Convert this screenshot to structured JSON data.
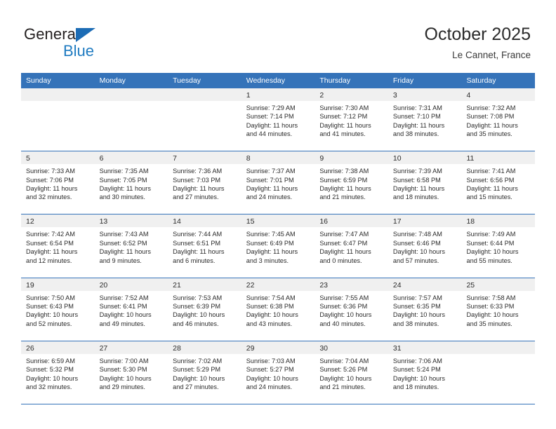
{
  "logo": {
    "word_one": "General",
    "word_two": "Blue",
    "triangle_icon": "triangle-icon",
    "brand_blue": "#1f7bc1",
    "brand_dark": "#231f20"
  },
  "header": {
    "title": "October 2025",
    "location": "Le Cannet, France"
  },
  "theme": {
    "header_blue": "#3573b9",
    "daynum_band": "#f0f0f0",
    "text": "#2b2b2b"
  },
  "weekdays": [
    "Sunday",
    "Monday",
    "Tuesday",
    "Wednesday",
    "Thursday",
    "Friday",
    "Saturday"
  ],
  "weeks": [
    [
      {
        "day": "",
        "empty": true,
        "sunrise": "",
        "sunset": "",
        "daylight_1": "",
        "daylight_2": ""
      },
      {
        "day": "",
        "empty": true,
        "sunrise": "",
        "sunset": "",
        "daylight_1": "",
        "daylight_2": ""
      },
      {
        "day": "",
        "empty": true,
        "sunrise": "",
        "sunset": "",
        "daylight_1": "",
        "daylight_2": ""
      },
      {
        "day": "1",
        "empty": false,
        "sunrise": "Sunrise: 7:29 AM",
        "sunset": "Sunset: 7:14 PM",
        "daylight_1": "Daylight: 11 hours",
        "daylight_2": "and 44 minutes."
      },
      {
        "day": "2",
        "empty": false,
        "sunrise": "Sunrise: 7:30 AM",
        "sunset": "Sunset: 7:12 PM",
        "daylight_1": "Daylight: 11 hours",
        "daylight_2": "and 41 minutes."
      },
      {
        "day": "3",
        "empty": false,
        "sunrise": "Sunrise: 7:31 AM",
        "sunset": "Sunset: 7:10 PM",
        "daylight_1": "Daylight: 11 hours",
        "daylight_2": "and 38 minutes."
      },
      {
        "day": "4",
        "empty": false,
        "sunrise": "Sunrise: 7:32 AM",
        "sunset": "Sunset: 7:08 PM",
        "daylight_1": "Daylight: 11 hours",
        "daylight_2": "and 35 minutes."
      }
    ],
    [
      {
        "day": "5",
        "empty": false,
        "sunrise": "Sunrise: 7:33 AM",
        "sunset": "Sunset: 7:06 PM",
        "daylight_1": "Daylight: 11 hours",
        "daylight_2": "and 32 minutes."
      },
      {
        "day": "6",
        "empty": false,
        "sunrise": "Sunrise: 7:35 AM",
        "sunset": "Sunset: 7:05 PM",
        "daylight_1": "Daylight: 11 hours",
        "daylight_2": "and 30 minutes."
      },
      {
        "day": "7",
        "empty": false,
        "sunrise": "Sunrise: 7:36 AM",
        "sunset": "Sunset: 7:03 PM",
        "daylight_1": "Daylight: 11 hours",
        "daylight_2": "and 27 minutes."
      },
      {
        "day": "8",
        "empty": false,
        "sunrise": "Sunrise: 7:37 AM",
        "sunset": "Sunset: 7:01 PM",
        "daylight_1": "Daylight: 11 hours",
        "daylight_2": "and 24 minutes."
      },
      {
        "day": "9",
        "empty": false,
        "sunrise": "Sunrise: 7:38 AM",
        "sunset": "Sunset: 6:59 PM",
        "daylight_1": "Daylight: 11 hours",
        "daylight_2": "and 21 minutes."
      },
      {
        "day": "10",
        "empty": false,
        "sunrise": "Sunrise: 7:39 AM",
        "sunset": "Sunset: 6:58 PM",
        "daylight_1": "Daylight: 11 hours",
        "daylight_2": "and 18 minutes."
      },
      {
        "day": "11",
        "empty": false,
        "sunrise": "Sunrise: 7:41 AM",
        "sunset": "Sunset: 6:56 PM",
        "daylight_1": "Daylight: 11 hours",
        "daylight_2": "and 15 minutes."
      }
    ],
    [
      {
        "day": "12",
        "empty": false,
        "sunrise": "Sunrise: 7:42 AM",
        "sunset": "Sunset: 6:54 PM",
        "daylight_1": "Daylight: 11 hours",
        "daylight_2": "and 12 minutes."
      },
      {
        "day": "13",
        "empty": false,
        "sunrise": "Sunrise: 7:43 AM",
        "sunset": "Sunset: 6:52 PM",
        "daylight_1": "Daylight: 11 hours",
        "daylight_2": "and 9 minutes."
      },
      {
        "day": "14",
        "empty": false,
        "sunrise": "Sunrise: 7:44 AM",
        "sunset": "Sunset: 6:51 PM",
        "daylight_1": "Daylight: 11 hours",
        "daylight_2": "and 6 minutes."
      },
      {
        "day": "15",
        "empty": false,
        "sunrise": "Sunrise: 7:45 AM",
        "sunset": "Sunset: 6:49 PM",
        "daylight_1": "Daylight: 11 hours",
        "daylight_2": "and 3 minutes."
      },
      {
        "day": "16",
        "empty": false,
        "sunrise": "Sunrise: 7:47 AM",
        "sunset": "Sunset: 6:47 PM",
        "daylight_1": "Daylight: 11 hours",
        "daylight_2": "and 0 minutes."
      },
      {
        "day": "17",
        "empty": false,
        "sunrise": "Sunrise: 7:48 AM",
        "sunset": "Sunset: 6:46 PM",
        "daylight_1": "Daylight: 10 hours",
        "daylight_2": "and 57 minutes."
      },
      {
        "day": "18",
        "empty": false,
        "sunrise": "Sunrise: 7:49 AM",
        "sunset": "Sunset: 6:44 PM",
        "daylight_1": "Daylight: 10 hours",
        "daylight_2": "and 55 minutes."
      }
    ],
    [
      {
        "day": "19",
        "empty": false,
        "sunrise": "Sunrise: 7:50 AM",
        "sunset": "Sunset: 6:43 PM",
        "daylight_1": "Daylight: 10 hours",
        "daylight_2": "and 52 minutes."
      },
      {
        "day": "20",
        "empty": false,
        "sunrise": "Sunrise: 7:52 AM",
        "sunset": "Sunset: 6:41 PM",
        "daylight_1": "Daylight: 10 hours",
        "daylight_2": "and 49 minutes."
      },
      {
        "day": "21",
        "empty": false,
        "sunrise": "Sunrise: 7:53 AM",
        "sunset": "Sunset: 6:39 PM",
        "daylight_1": "Daylight: 10 hours",
        "daylight_2": "and 46 minutes."
      },
      {
        "day": "22",
        "empty": false,
        "sunrise": "Sunrise: 7:54 AM",
        "sunset": "Sunset: 6:38 PM",
        "daylight_1": "Daylight: 10 hours",
        "daylight_2": "and 43 minutes."
      },
      {
        "day": "23",
        "empty": false,
        "sunrise": "Sunrise: 7:55 AM",
        "sunset": "Sunset: 6:36 PM",
        "daylight_1": "Daylight: 10 hours",
        "daylight_2": "and 40 minutes."
      },
      {
        "day": "24",
        "empty": false,
        "sunrise": "Sunrise: 7:57 AM",
        "sunset": "Sunset: 6:35 PM",
        "daylight_1": "Daylight: 10 hours",
        "daylight_2": "and 38 minutes."
      },
      {
        "day": "25",
        "empty": false,
        "sunrise": "Sunrise: 7:58 AM",
        "sunset": "Sunset: 6:33 PM",
        "daylight_1": "Daylight: 10 hours",
        "daylight_2": "and 35 minutes."
      }
    ],
    [
      {
        "day": "26",
        "empty": false,
        "sunrise": "Sunrise: 6:59 AM",
        "sunset": "Sunset: 5:32 PM",
        "daylight_1": "Daylight: 10 hours",
        "daylight_2": "and 32 minutes."
      },
      {
        "day": "27",
        "empty": false,
        "sunrise": "Sunrise: 7:00 AM",
        "sunset": "Sunset: 5:30 PM",
        "daylight_1": "Daylight: 10 hours",
        "daylight_2": "and 29 minutes."
      },
      {
        "day": "28",
        "empty": false,
        "sunrise": "Sunrise: 7:02 AM",
        "sunset": "Sunset: 5:29 PM",
        "daylight_1": "Daylight: 10 hours",
        "daylight_2": "and 27 minutes."
      },
      {
        "day": "29",
        "empty": false,
        "sunrise": "Sunrise: 7:03 AM",
        "sunset": "Sunset: 5:27 PM",
        "daylight_1": "Daylight: 10 hours",
        "daylight_2": "and 24 minutes."
      },
      {
        "day": "30",
        "empty": false,
        "sunrise": "Sunrise: 7:04 AM",
        "sunset": "Sunset: 5:26 PM",
        "daylight_1": "Daylight: 10 hours",
        "daylight_2": "and 21 minutes."
      },
      {
        "day": "31",
        "empty": false,
        "sunrise": "Sunrise: 7:06 AM",
        "sunset": "Sunset: 5:24 PM",
        "daylight_1": "Daylight: 10 hours",
        "daylight_2": "and 18 minutes."
      },
      {
        "day": "",
        "empty": true,
        "sunrise": "",
        "sunset": "",
        "daylight_1": "",
        "daylight_2": ""
      }
    ]
  ]
}
